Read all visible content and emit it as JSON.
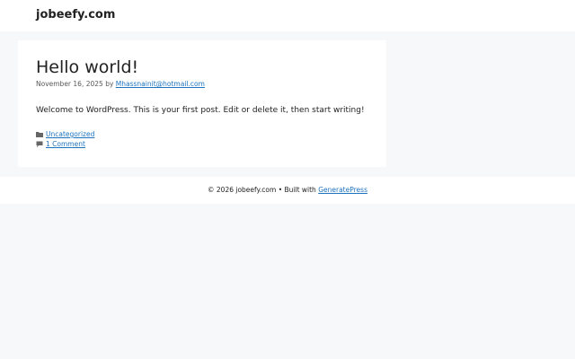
{
  "header": {
    "site_title": "jobeefy.com"
  },
  "post": {
    "title": "Hello world!",
    "date": "November 16, 2025",
    "by_label": "by",
    "author": "Mhassnainit@hotmail.com",
    "content": "Welcome to WordPress. This is your first post. Edit or delete it, then start writing!",
    "category": "Uncategorized",
    "comments": "1 Comment"
  },
  "footer": {
    "copyright": "© 2026 jobeefy.com • Built with",
    "theme_link": "GeneratePress"
  },
  "colors": {
    "link": "#1e73be",
    "background": "#f7f8f9",
    "surface": "#ffffff"
  }
}
